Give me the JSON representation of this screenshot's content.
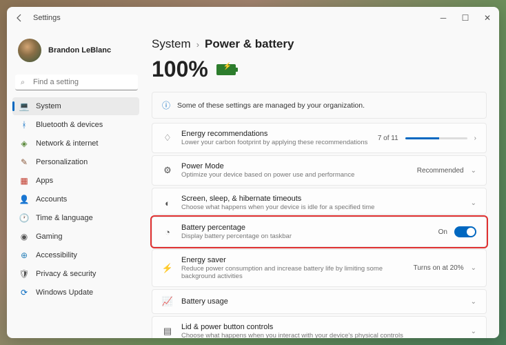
{
  "titlebar": {
    "title": "Settings"
  },
  "profile": {
    "name": "Brandon LeBlanc"
  },
  "search": {
    "placeholder": "Find a setting"
  },
  "nav": {
    "items": [
      {
        "label": "System",
        "icon": "💻",
        "color": "#0067c0"
      },
      {
        "label": "Bluetooth & devices",
        "icon": "ᚼ",
        "color": "#0067c0"
      },
      {
        "label": "Network & internet",
        "icon": "◈",
        "color": "#5b8a3d"
      },
      {
        "label": "Personalization",
        "icon": "✎",
        "color": "#8b5a3c"
      },
      {
        "label": "Apps",
        "icon": "▦",
        "color": "#c0392b"
      },
      {
        "label": "Accounts",
        "icon": "👤",
        "color": "#16a085"
      },
      {
        "label": "Time & language",
        "icon": "🕐",
        "color": "#2980b9"
      },
      {
        "label": "Gaming",
        "icon": "◉",
        "color": "#555"
      },
      {
        "label": "Accessibility",
        "icon": "⊕",
        "color": "#2980b9"
      },
      {
        "label": "Privacy & security",
        "icon": "🛡",
        "color": "#555"
      },
      {
        "label": "Windows Update",
        "icon": "⟳",
        "color": "#0067c0"
      }
    ]
  },
  "breadcrumb": {
    "root": "System",
    "current": "Power & battery"
  },
  "battery": {
    "percent": "100%"
  },
  "banner": {
    "text": "Some of these settings are managed by your organization."
  },
  "cards": {
    "energy": {
      "title": "Energy recommendations",
      "sub": "Lower your carbon footprint by applying these recommendations",
      "count": "7 of 11"
    },
    "power_mode": {
      "title": "Power Mode",
      "sub": "Optimize your device based on power use and performance",
      "value": "Recommended"
    },
    "sleep": {
      "title": "Screen, sleep, & hibernate timeouts",
      "sub": "Choose what happens when your device is idle for a specified time"
    },
    "battery_pct": {
      "title": "Battery percentage",
      "sub": "Display battery percentage on taskbar",
      "state": "On"
    },
    "energy_saver": {
      "title": "Energy saver",
      "sub": "Reduce power consumption and increase battery life by limiting some background activities",
      "value": "Turns on at 20%"
    },
    "battery_usage": {
      "title": "Battery usage"
    },
    "lid": {
      "title": "Lid & power button controls",
      "sub": "Choose what happens when you interact with your device's physical controls"
    }
  }
}
